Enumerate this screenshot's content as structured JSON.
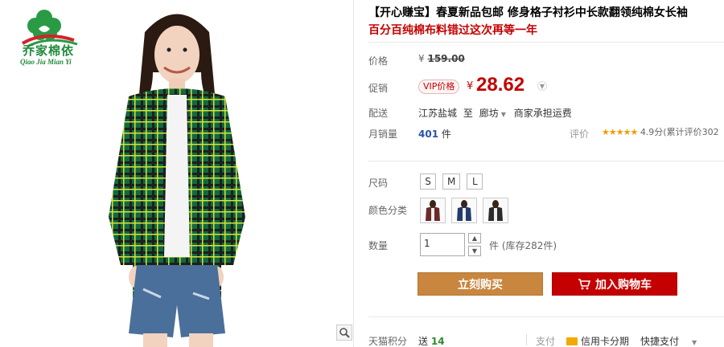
{
  "brand": {
    "name_cn": "乔家棉依",
    "name_en": "Qiao Jia Mian Yi",
    "color": "#1f8a3a"
  },
  "product": {
    "title": "【开心赚宝】春夏新品包邮 修身格子衬衫中长款翻领纯棉女长袖",
    "subtitle": "百分百纯棉布料错过这次再等一年"
  },
  "price": {
    "label": "价格",
    "currency": "¥",
    "original": "159.00"
  },
  "promo": {
    "label": "促销",
    "badge": "VIP价格",
    "currency": "¥",
    "price": "28.62",
    "color": "#c40000"
  },
  "shipping": {
    "label": "配送",
    "from": "江苏盐城",
    "to_word": "至",
    "to": "廊坊",
    "fee_text": "商家承担运费"
  },
  "sales": {
    "label": "月销量",
    "count": "401",
    "unit": "件"
  },
  "rating": {
    "label": "评价",
    "stars": "★★★★★",
    "text": "4.9分(累计评价302"
  },
  "size": {
    "label": "尺码",
    "options": [
      "S",
      "M",
      "L"
    ]
  },
  "color_category": {
    "label": "颜色分类",
    "options": [
      "shirt-dark-thumbnail",
      "shirt-blue-thumbnail",
      "shirt-black-thumbnail"
    ]
  },
  "quantity": {
    "label": "数量",
    "value": "1",
    "stock_text": "件 (库存282件)"
  },
  "actions": {
    "buy_now": "立刻购买",
    "add_to_cart": "加入购物车"
  },
  "footer": {
    "points_label": "天猫积分",
    "points_prefix": "送",
    "points_value": "14",
    "pay_label": "支付",
    "pay_card": "信用卡分期",
    "pay_quick": "快捷支付"
  },
  "icons": {
    "zoom": "magnifier-icon",
    "cart": "cart-icon"
  }
}
